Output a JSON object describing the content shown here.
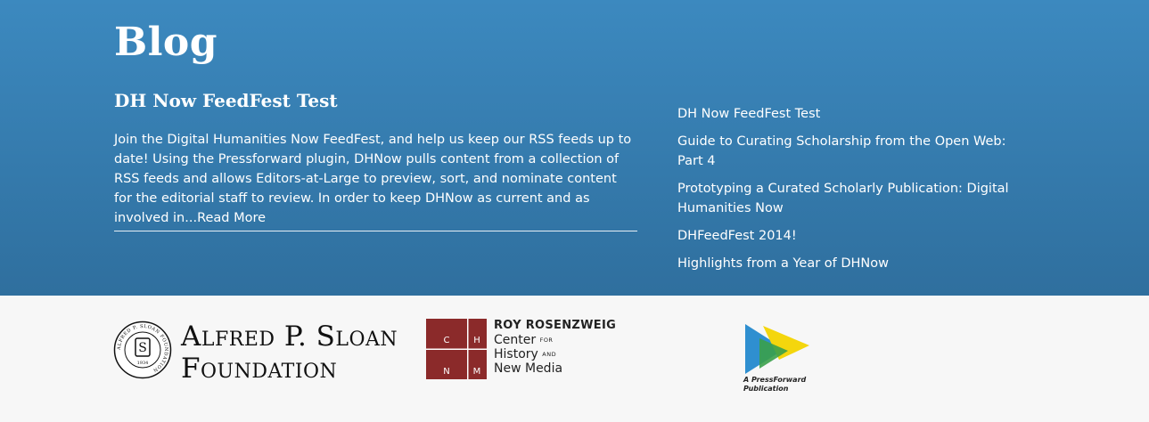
{
  "blog": {
    "title": "Blog",
    "post": {
      "title": "DH Now FeedFest Test",
      "excerpt": "Join the Digital Humanities Now FeedFest, and help us keep our RSS feeds up to date! Using the Pressforward plugin, DHNow pulls content from a collection of RSS feeds and allows Editors-at-Large to preview, sort, and nominate content for the editorial staff to review. In order to keep DHNow as current and as involved in...",
      "read_more": "Read More"
    },
    "recent_posts": [
      "DH Now FeedFest Test",
      "Guide to Curating Scholarship from the Open Web: Part 4",
      "Prototyping a Curated Scholarly Publication: Digital Humanities Now",
      "DHFeedFest 2014!",
      "Highlights from a Year of DHNow"
    ]
  },
  "footer": {
    "sloan": {
      "line1": "Alfred P. Sloan",
      "line2": "Foundation",
      "seal_top": "ALFRED P. SLOAN FOUNDATION",
      "seal_letter": "S",
      "seal_year": "1934"
    },
    "chnm": {
      "grid_letters": [
        "C",
        "H",
        "N",
        "M"
      ],
      "line1": "ROY ROSENZWEIG",
      "line2": "Center",
      "line2_small": "FOR",
      "line3": "History",
      "line3_small": "AND",
      "line4": "New Media",
      "color": "#8b2a2a"
    },
    "pressforward": {
      "line1": "A PressForward",
      "line2": "Publication"
    }
  }
}
